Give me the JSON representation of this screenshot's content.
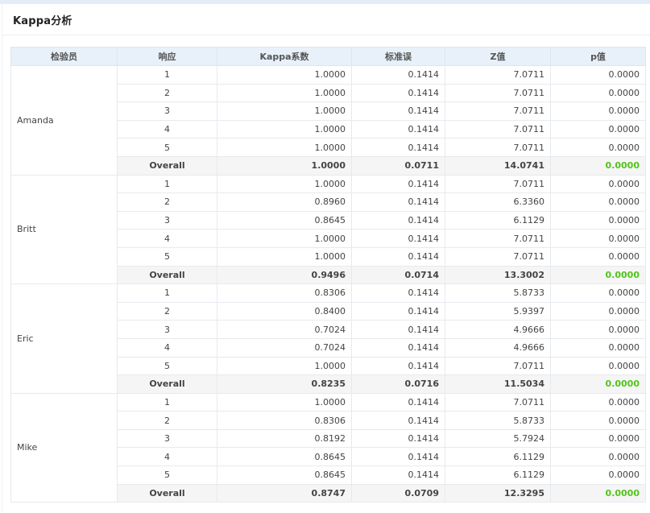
{
  "title": "Kappa分析",
  "columns": [
    "检验员",
    "响应",
    "Kappa系数",
    "标准误",
    "Z值",
    "p值"
  ],
  "groups": [
    {
      "rater": "Amanda",
      "rows": [
        {
          "response": "1",
          "kappa": "1.0000",
          "se": "0.1414",
          "z": "7.0711",
          "p": "0.0000"
        },
        {
          "response": "2",
          "kappa": "1.0000",
          "se": "0.1414",
          "z": "7.0711",
          "p": "0.0000"
        },
        {
          "response": "3",
          "kappa": "1.0000",
          "se": "0.1414",
          "z": "7.0711",
          "p": "0.0000"
        },
        {
          "response": "4",
          "kappa": "1.0000",
          "se": "0.1414",
          "z": "7.0711",
          "p": "0.0000"
        },
        {
          "response": "5",
          "kappa": "1.0000",
          "se": "0.1414",
          "z": "7.0711",
          "p": "0.0000"
        },
        {
          "response": "Overall",
          "kappa": "1.0000",
          "se": "0.0711",
          "z": "14.0741",
          "p": "0.0000"
        }
      ]
    },
    {
      "rater": "Britt",
      "rows": [
        {
          "response": "1",
          "kappa": "1.0000",
          "se": "0.1414",
          "z": "7.0711",
          "p": "0.0000"
        },
        {
          "response": "2",
          "kappa": "0.8960",
          "se": "0.1414",
          "z": "6.3360",
          "p": "0.0000"
        },
        {
          "response": "3",
          "kappa": "0.8645",
          "se": "0.1414",
          "z": "6.1129",
          "p": "0.0000"
        },
        {
          "response": "4",
          "kappa": "1.0000",
          "se": "0.1414",
          "z": "7.0711",
          "p": "0.0000"
        },
        {
          "response": "5",
          "kappa": "1.0000",
          "se": "0.1414",
          "z": "7.0711",
          "p": "0.0000"
        },
        {
          "response": "Overall",
          "kappa": "0.9496",
          "se": "0.0714",
          "z": "13.3002",
          "p": "0.0000"
        }
      ]
    },
    {
      "rater": "Eric",
      "rows": [
        {
          "response": "1",
          "kappa": "0.8306",
          "se": "0.1414",
          "z": "5.8733",
          "p": "0.0000"
        },
        {
          "response": "2",
          "kappa": "0.8400",
          "se": "0.1414",
          "z": "5.9397",
          "p": "0.0000"
        },
        {
          "response": "3",
          "kappa": "0.7024",
          "se": "0.1414",
          "z": "4.9666",
          "p": "0.0000"
        },
        {
          "response": "4",
          "kappa": "0.7024",
          "se": "0.1414",
          "z": "4.9666",
          "p": "0.0000"
        },
        {
          "response": "5",
          "kappa": "1.0000",
          "se": "0.1414",
          "z": "7.0711",
          "p": "0.0000"
        },
        {
          "response": "Overall",
          "kappa": "0.8235",
          "se": "0.0716",
          "z": "11.5034",
          "p": "0.0000"
        }
      ]
    },
    {
      "rater": "Mike",
      "rows": [
        {
          "response": "1",
          "kappa": "1.0000",
          "se": "0.1414",
          "z": "7.0711",
          "p": "0.0000"
        },
        {
          "response": "2",
          "kappa": "0.8306",
          "se": "0.1414",
          "z": "5.8733",
          "p": "0.0000"
        },
        {
          "response": "3",
          "kappa": "0.8192",
          "se": "0.1414",
          "z": "5.7924",
          "p": "0.0000"
        },
        {
          "response": "4",
          "kappa": "0.8645",
          "se": "0.1414",
          "z": "6.1129",
          "p": "0.0000"
        },
        {
          "response": "5",
          "kappa": "0.8645",
          "se": "0.1414",
          "z": "6.1129",
          "p": "0.0000"
        },
        {
          "response": "Overall",
          "kappa": "0.8747",
          "se": "0.0709",
          "z": "12.3295",
          "p": "0.0000"
        }
      ]
    }
  ],
  "colors": {
    "header_bg": "#e8f1fa",
    "p_value": "#52c41a",
    "overall_bg": "#f5f5f5"
  }
}
